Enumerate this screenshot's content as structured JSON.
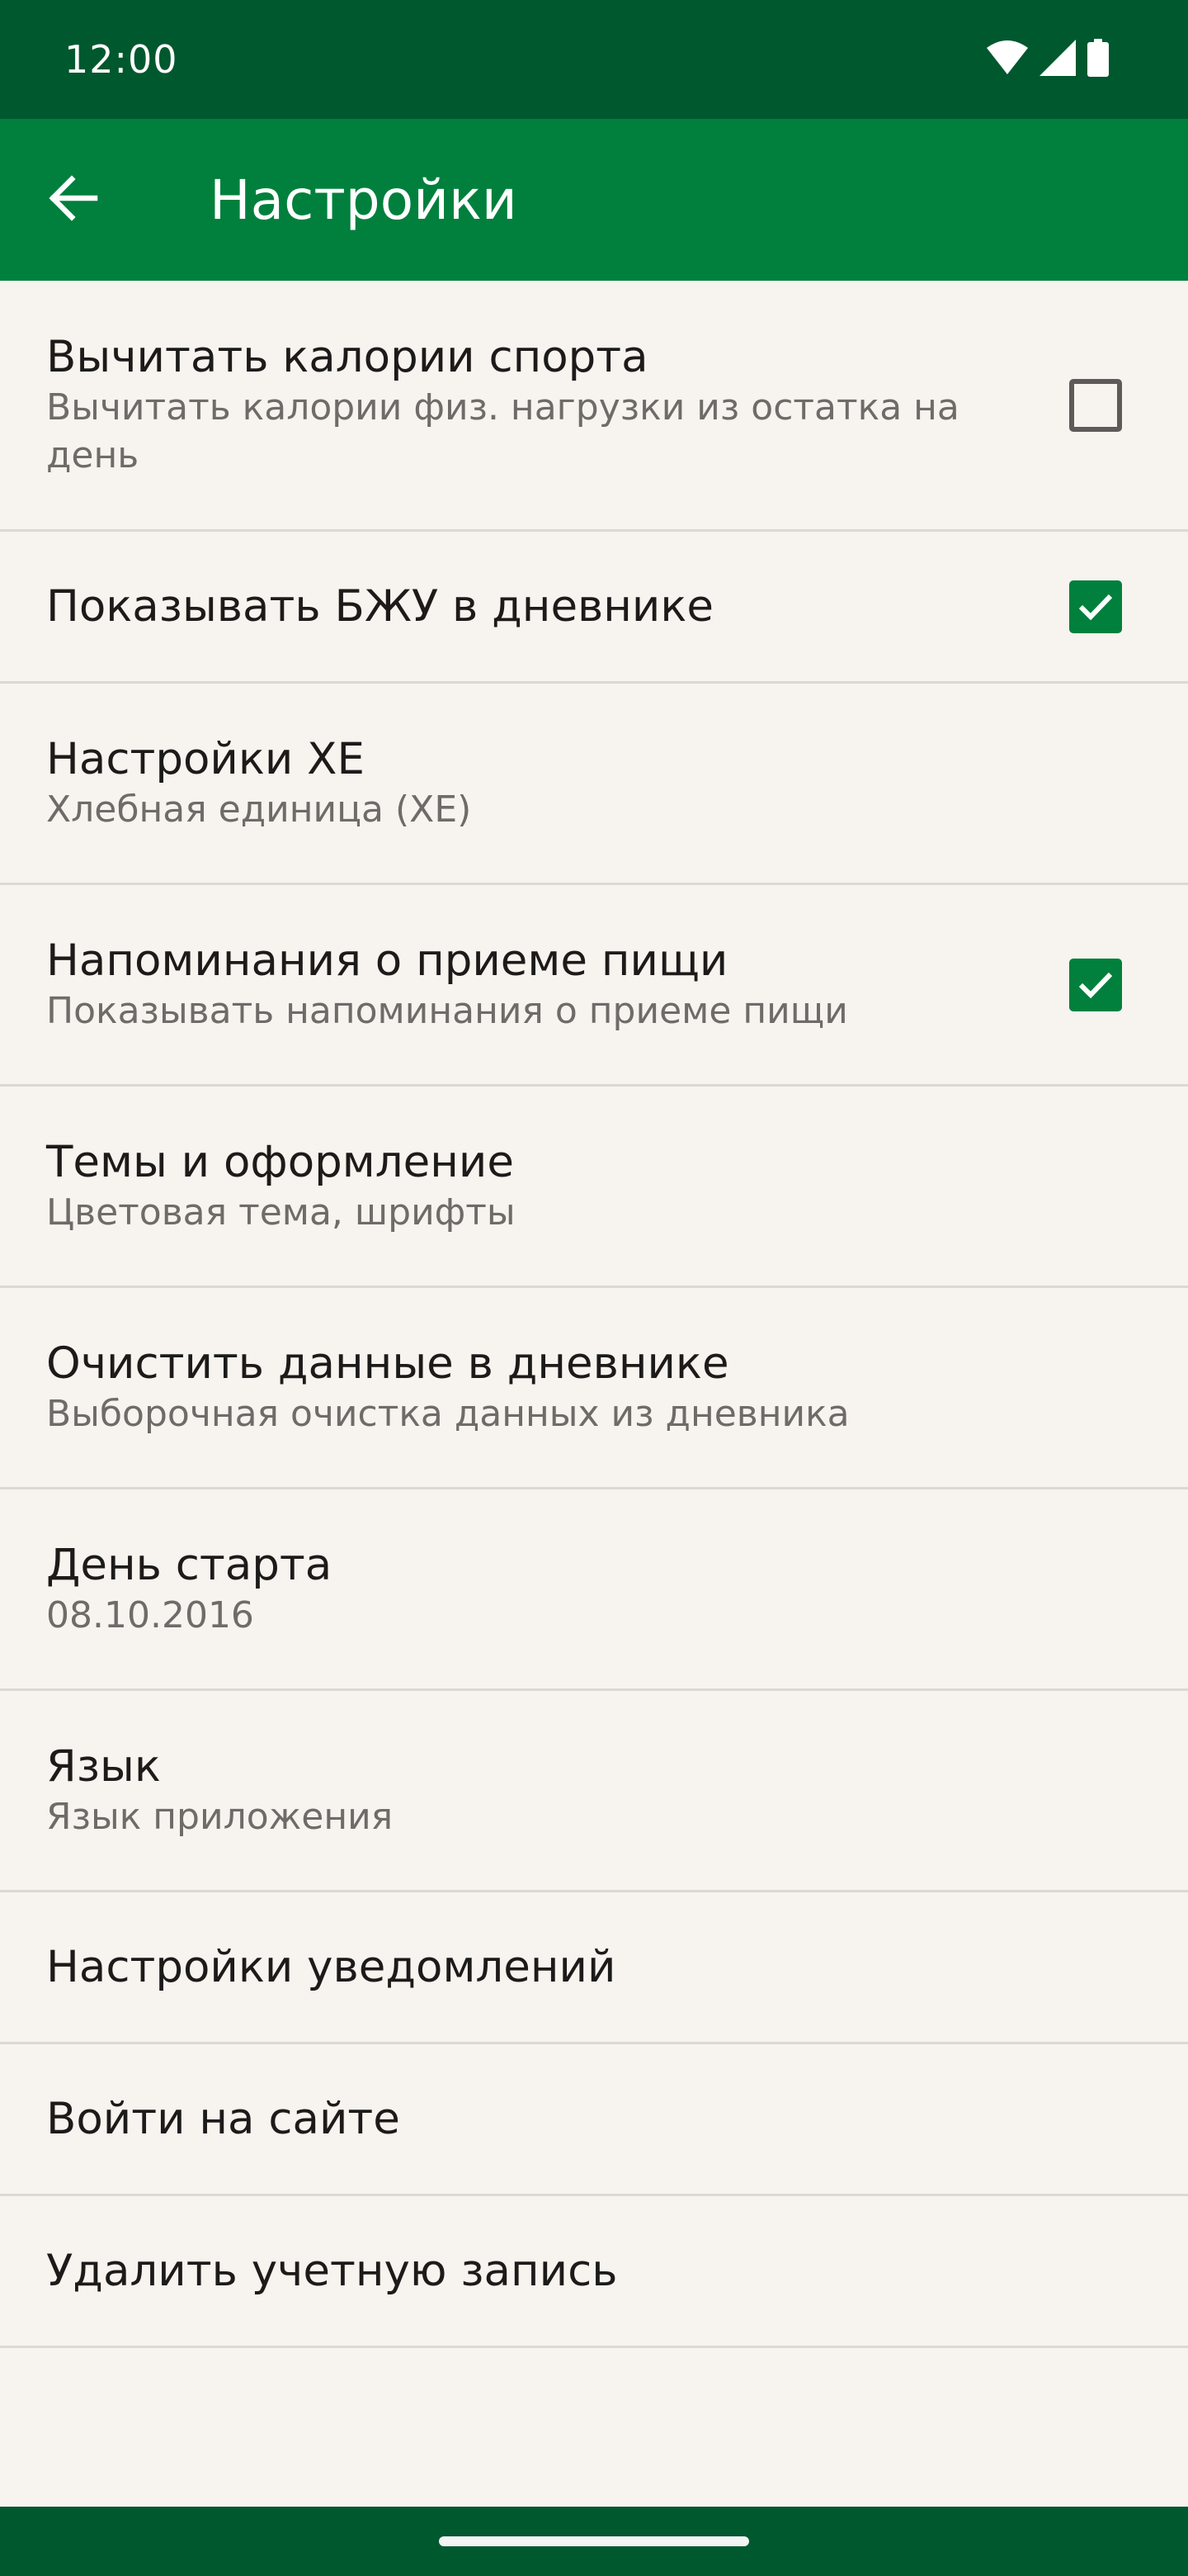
{
  "status_bar": {
    "time": "12:00",
    "icons": [
      "wifi-icon",
      "cellular-signal-icon",
      "battery-icon"
    ]
  },
  "app_bar": {
    "back_icon": "arrow-left-icon",
    "title": "Настройки"
  },
  "colors": {
    "status_bar": "#00582e",
    "app_bar": "#00803c",
    "background": "#f7f3ef",
    "checkbox_checked": "#00803c",
    "divider": "#dcd8d4"
  },
  "settings": [
    {
      "title": "Вычитать калории спорта",
      "subtitle": "Вычитать калории физ. нагрузки из остатка на день",
      "checkbox": true,
      "checked": false
    },
    {
      "title": "Показывать БЖУ в дневнике",
      "checkbox": true,
      "checked": true
    },
    {
      "title": "Настройки ХЕ",
      "subtitle": "Хлебная единица (ХЕ)"
    },
    {
      "title": "Напоминания о приеме пищи",
      "subtitle": "Показывать напоминания о приеме пищи",
      "checkbox": true,
      "checked": true
    },
    {
      "title": "Темы и оформление",
      "subtitle": "Цветовая тема, шрифты"
    },
    {
      "title": "Очистить данные в дневнике",
      "subtitle": "Выборочная очистка данных из дневника"
    },
    {
      "title": "День старта",
      "subtitle": "08.10.2016"
    },
    {
      "title": "Язык",
      "subtitle": "Язык приложения"
    },
    {
      "title": "Настройки уведомлений"
    },
    {
      "title": "Войти на сайте"
    },
    {
      "title": "Удалить учетную запись"
    }
  ]
}
